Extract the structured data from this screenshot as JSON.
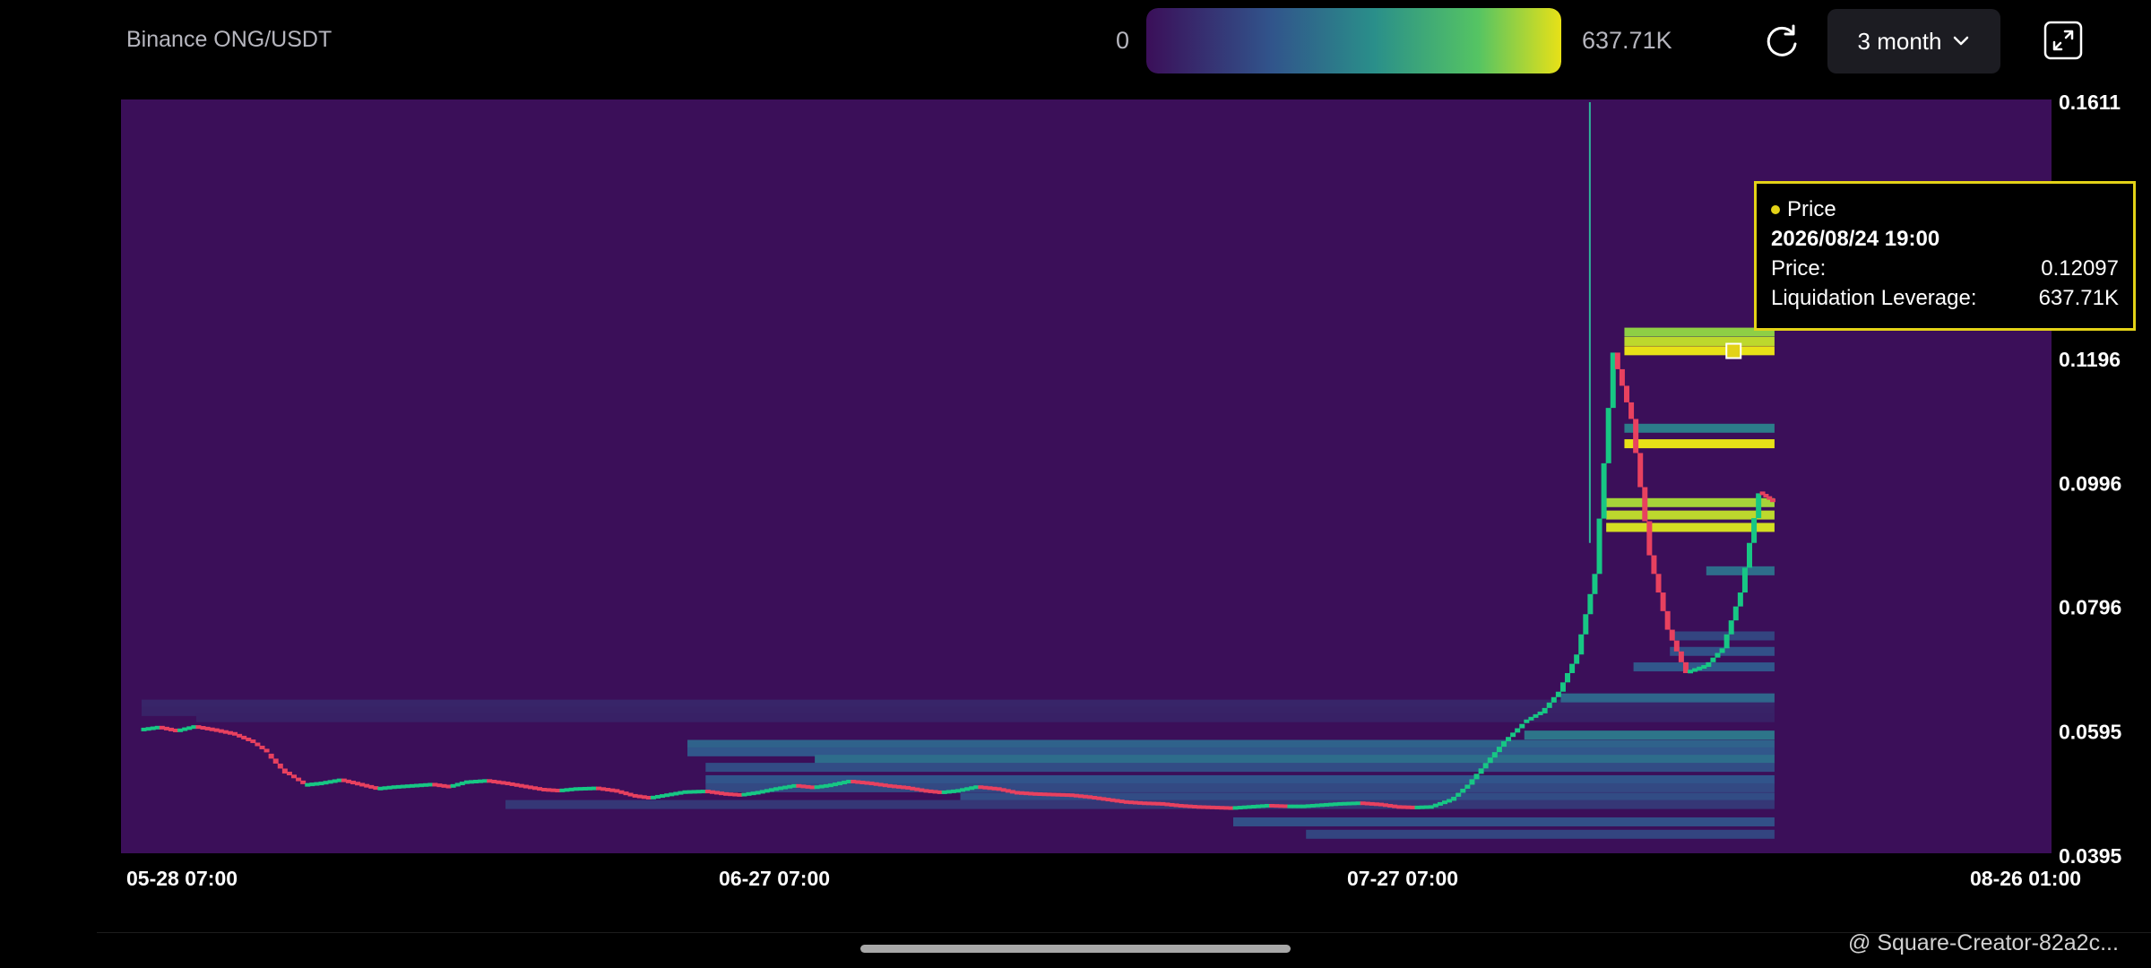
{
  "header": {
    "pair_title": "Binance ONG/USDT",
    "scale_min_label": "0",
    "scale_max_label": "637.71K",
    "range_selected": "3 month",
    "refresh_icon": "refresh-icon",
    "expand_icon": "expand-icon",
    "dropdown_icon": "chevron-down-icon"
  },
  "colors": {
    "background": "#000000",
    "heatmap_low": "#3b0f59",
    "heatmap_mid": "#2e8a8c",
    "heatmap_high": "#e8e117",
    "candle_up": "#17c784",
    "candle_down": "#e8415f",
    "tooltip_border": "#e3d217"
  },
  "tooltip": {
    "series": "Price",
    "datetime": "2026/08/24 19:00",
    "price_label": "Price:",
    "price_value": "0.12097",
    "leverage_label": "Liquidation Leverage:",
    "leverage_value": "637.71K"
  },
  "watermark": "@ Square-Creator-82a2c...",
  "chart_data": {
    "type": "heatmap",
    "title": "Binance ONG/USDT",
    "color_scale": {
      "min": 0,
      "max": 637710,
      "min_label": "0",
      "max_label": "637.71K"
    },
    "x_ticks": [
      "05-28 07:00",
      "06-27 07:00",
      "07-27 07:00",
      "08-26 01:00"
    ],
    "x_tick_days": [
      0,
      30,
      60,
      89.75
    ],
    "y_ticks": [
      "0.1611",
      "0.1196",
      "0.0996",
      "0.0796",
      "0.0595",
      "0.0395"
    ],
    "y_tick_values": [
      0.1611,
      0.1196,
      0.0996,
      0.0796,
      0.0595,
      0.0395
    ],
    "ylim": [
      0.0395,
      0.1611
    ],
    "grid": false,
    "price_path": [
      [
        0,
        0.0598
      ],
      [
        1,
        0.0602
      ],
      [
        2,
        0.0596
      ],
      [
        3,
        0.0603
      ],
      [
        4,
        0.0598
      ],
      [
        5,
        0.0592
      ],
      [
        6,
        0.058
      ],
      [
        7,
        0.056
      ],
      [
        8,
        0.0528
      ],
      [
        9,
        0.0509
      ],
      [
        10,
        0.0512
      ],
      [
        11,
        0.0517
      ],
      [
        12,
        0.051
      ],
      [
        13,
        0.0503
      ],
      [
        14,
        0.0506
      ],
      [
        15,
        0.0508
      ],
      [
        16,
        0.051
      ],
      [
        17,
        0.0506
      ],
      [
        18,
        0.0514
      ],
      [
        19,
        0.0516
      ],
      [
        20,
        0.0512
      ],
      [
        21,
        0.0507
      ],
      [
        22,
        0.0502
      ],
      [
        23,
        0.05
      ],
      [
        24,
        0.0503
      ],
      [
        25,
        0.0504
      ],
      [
        26,
        0.05
      ],
      [
        27,
        0.0492
      ],
      [
        28,
        0.0488
      ],
      [
        29,
        0.0493
      ],
      [
        30,
        0.0498
      ],
      [
        31,
        0.0499
      ],
      [
        32,
        0.0495
      ],
      [
        33,
        0.0493
      ],
      [
        34,
        0.0497
      ],
      [
        35,
        0.0503
      ],
      [
        36,
        0.0508
      ],
      [
        37,
        0.0505
      ],
      [
        38,
        0.0509
      ],
      [
        39,
        0.0515
      ],
      [
        40,
        0.0512
      ],
      [
        41,
        0.0508
      ],
      [
        42,
        0.0505
      ],
      [
        43,
        0.05
      ],
      [
        44,
        0.0497
      ],
      [
        45,
        0.05
      ],
      [
        46,
        0.0506
      ],
      [
        47,
        0.0503
      ],
      [
        48,
        0.0497
      ],
      [
        49,
        0.0495
      ],
      [
        50,
        0.0494
      ],
      [
        51,
        0.0493
      ],
      [
        52,
        0.049
      ],
      [
        53,
        0.0486
      ],
      [
        54,
        0.0482
      ],
      [
        55,
        0.048
      ],
      [
        56,
        0.0479
      ],
      [
        57,
        0.0476
      ],
      [
        58,
        0.0474
      ],
      [
        59,
        0.0473
      ],
      [
        60,
        0.0472
      ],
      [
        61,
        0.0474
      ],
      [
        62,
        0.0476
      ],
      [
        63,
        0.0475
      ],
      [
        64,
        0.0475
      ],
      [
        65,
        0.0477
      ],
      [
        66,
        0.0479
      ],
      [
        67,
        0.048
      ],
      [
        68,
        0.0478
      ],
      [
        69,
        0.0474
      ],
      [
        70,
        0.0473
      ],
      [
        71,
        0.0474
      ],
      [
        72,
        0.0484
      ],
      [
        73,
        0.051
      ],
      [
        74,
        0.0545
      ],
      [
        75,
        0.058
      ],
      [
        76,
        0.0608
      ],
      [
        77,
        0.0625
      ],
      [
        78,
        0.066
      ],
      [
        79,
        0.072
      ],
      [
        80,
        0.085
      ],
      [
        81,
        0.1207
      ],
      [
        82,
        0.11
      ],
      [
        83,
        0.088
      ],
      [
        84,
        0.076
      ],
      [
        85,
        0.069
      ],
      [
        86,
        0.07
      ],
      [
        87,
        0.073
      ],
      [
        88,
        0.082
      ],
      [
        89,
        0.098
      ],
      [
        89.75,
        0.0965
      ]
    ],
    "wick_high": {
      "day": 79.6,
      "value": 0.1611
    },
    "liquidation_levels": [
      {
        "start_day": 0,
        "end_day": 89.75,
        "price": 0.064,
        "leverage": 60000
      },
      {
        "start_day": 0,
        "end_day": 89.75,
        "price": 0.0628,
        "leverage": 55000
      },
      {
        "start_day": 3,
        "end_day": 89.75,
        "price": 0.0618,
        "leverage": 50000
      },
      {
        "start_day": 30,
        "end_day": 89.75,
        "price": 0.0575,
        "leverage": 230000
      },
      {
        "start_day": 30,
        "end_day": 89.75,
        "price": 0.0563,
        "leverage": 200000
      },
      {
        "start_day": 37,
        "end_day": 89.75,
        "price": 0.0551,
        "leverage": 260000
      },
      {
        "start_day": 31,
        "end_day": 89.75,
        "price": 0.0538,
        "leverage": 170000
      },
      {
        "start_day": 31,
        "end_day": 89.75,
        "price": 0.0518,
        "leverage": 190000
      },
      {
        "start_day": 31,
        "end_day": 89.75,
        "price": 0.0505,
        "leverage": 160000
      },
      {
        "start_day": 45,
        "end_day": 89.75,
        "price": 0.049,
        "leverage": 170000
      },
      {
        "start_day": 20,
        "end_day": 89.75,
        "price": 0.0478,
        "leverage": 110000
      },
      {
        "start_day": 60,
        "end_day": 89.75,
        "price": 0.045,
        "leverage": 180000
      },
      {
        "start_day": 64,
        "end_day": 89.75,
        "price": 0.043,
        "leverage": 150000
      },
      {
        "start_day": 76,
        "end_day": 89.75,
        "price": 0.059,
        "leverage": 280000
      },
      {
        "start_day": 78,
        "end_day": 89.75,
        "price": 0.065,
        "leverage": 240000
      },
      {
        "start_day": 82,
        "end_day": 89.75,
        "price": 0.07,
        "leverage": 200000
      },
      {
        "start_day": 84,
        "end_day": 89.75,
        "price": 0.0725,
        "leverage": 180000
      },
      {
        "start_day": 84,
        "end_day": 89.75,
        "price": 0.075,
        "leverage": 150000
      },
      {
        "start_day": 86,
        "end_day": 89.75,
        "price": 0.0855,
        "leverage": 260000
      },
      {
        "start_day": 80.5,
        "end_day": 89.75,
        "price": 0.0925,
        "leverage": 620000
      },
      {
        "start_day": 80.5,
        "end_day": 89.75,
        "price": 0.0945,
        "leverage": 600000
      },
      {
        "start_day": 80.5,
        "end_day": 89.75,
        "price": 0.0965,
        "leverage": 580000
      },
      {
        "start_day": 81.5,
        "end_day": 89.75,
        "price": 0.106,
        "leverage": 637710
      },
      {
        "start_day": 81.5,
        "end_day": 89.75,
        "price": 0.1085,
        "leverage": 300000
      },
      {
        "start_day": 81.5,
        "end_day": 89.75,
        "price": 0.121,
        "leverage": 637710
      },
      {
        "start_day": 81.5,
        "end_day": 89.75,
        "price": 0.1225,
        "leverage": 600000
      },
      {
        "start_day": 81.5,
        "end_day": 89.75,
        "price": 0.124,
        "leverage": 560000
      }
    ],
    "highlight": {
      "series": "Price",
      "day": 87.5,
      "price": 0.12097,
      "leverage": 637710
    }
  }
}
